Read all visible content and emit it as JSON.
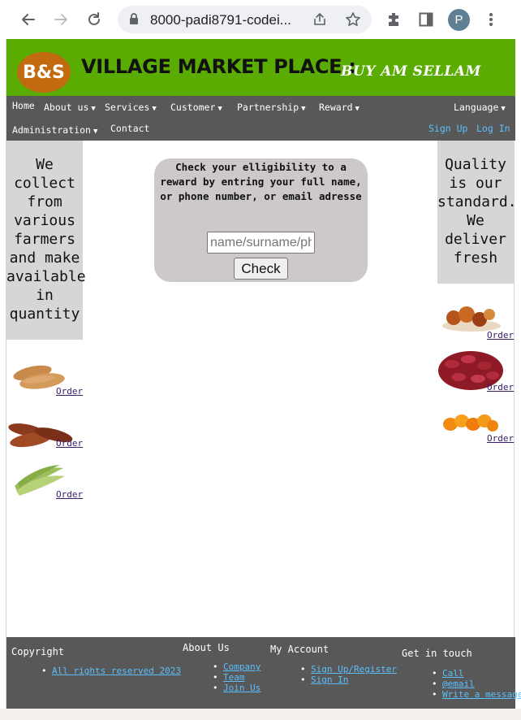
{
  "browser": {
    "url": "8000-padi8791-codei...",
    "profile_initial": "P"
  },
  "header": {
    "logo_text": "B&S",
    "title": "VILLAGE MARKET PLACE :",
    "slogan": "BUY AM SELLAM",
    "brand_color": "#5aab02"
  },
  "nav": {
    "home": "Home",
    "about": "About us",
    "services": "Services",
    "customer": "Customer",
    "partnership": "Partnership",
    "reward": "Reward",
    "language": "Language",
    "administration": "Administration",
    "contact": "Contact",
    "signup": "Sign Up",
    "login": "Log In"
  },
  "left_panel": {
    "text": "We collect from various farmers and make available in quantity",
    "products": [
      {
        "name": "sweet-potatoes",
        "order_label": "Order"
      },
      {
        "name": "dried-fish",
        "order_label": "Order"
      },
      {
        "name": "plantains",
        "order_label": "Order"
      }
    ]
  },
  "right_panel": {
    "text": "Quality is our standard. We deliver fresh",
    "products": [
      {
        "name": "palm-nuts",
        "order_label": "Order"
      },
      {
        "name": "red-beans",
        "order_label": "Order"
      },
      {
        "name": "peppers",
        "order_label": "Order"
      }
    ]
  },
  "reward_form": {
    "prompt": "Check your elligibility to a reward by entring your full name, or phone number, or email adresse",
    "input_placeholder": "name/surname/phone",
    "button_label": "Check"
  },
  "footer": {
    "copyright_heading": "Copyright",
    "copyright_link": "All rights reserved 2023",
    "about_heading": "About Us",
    "about_links": [
      "Company",
      "Team",
      "Join Us"
    ],
    "account_heading": "My Account",
    "account_links": [
      "Sign Up/Register",
      "Sign In"
    ],
    "contact_heading": "Get in touch",
    "contact_links": [
      "Call",
      "@email",
      "Write a message"
    ]
  }
}
